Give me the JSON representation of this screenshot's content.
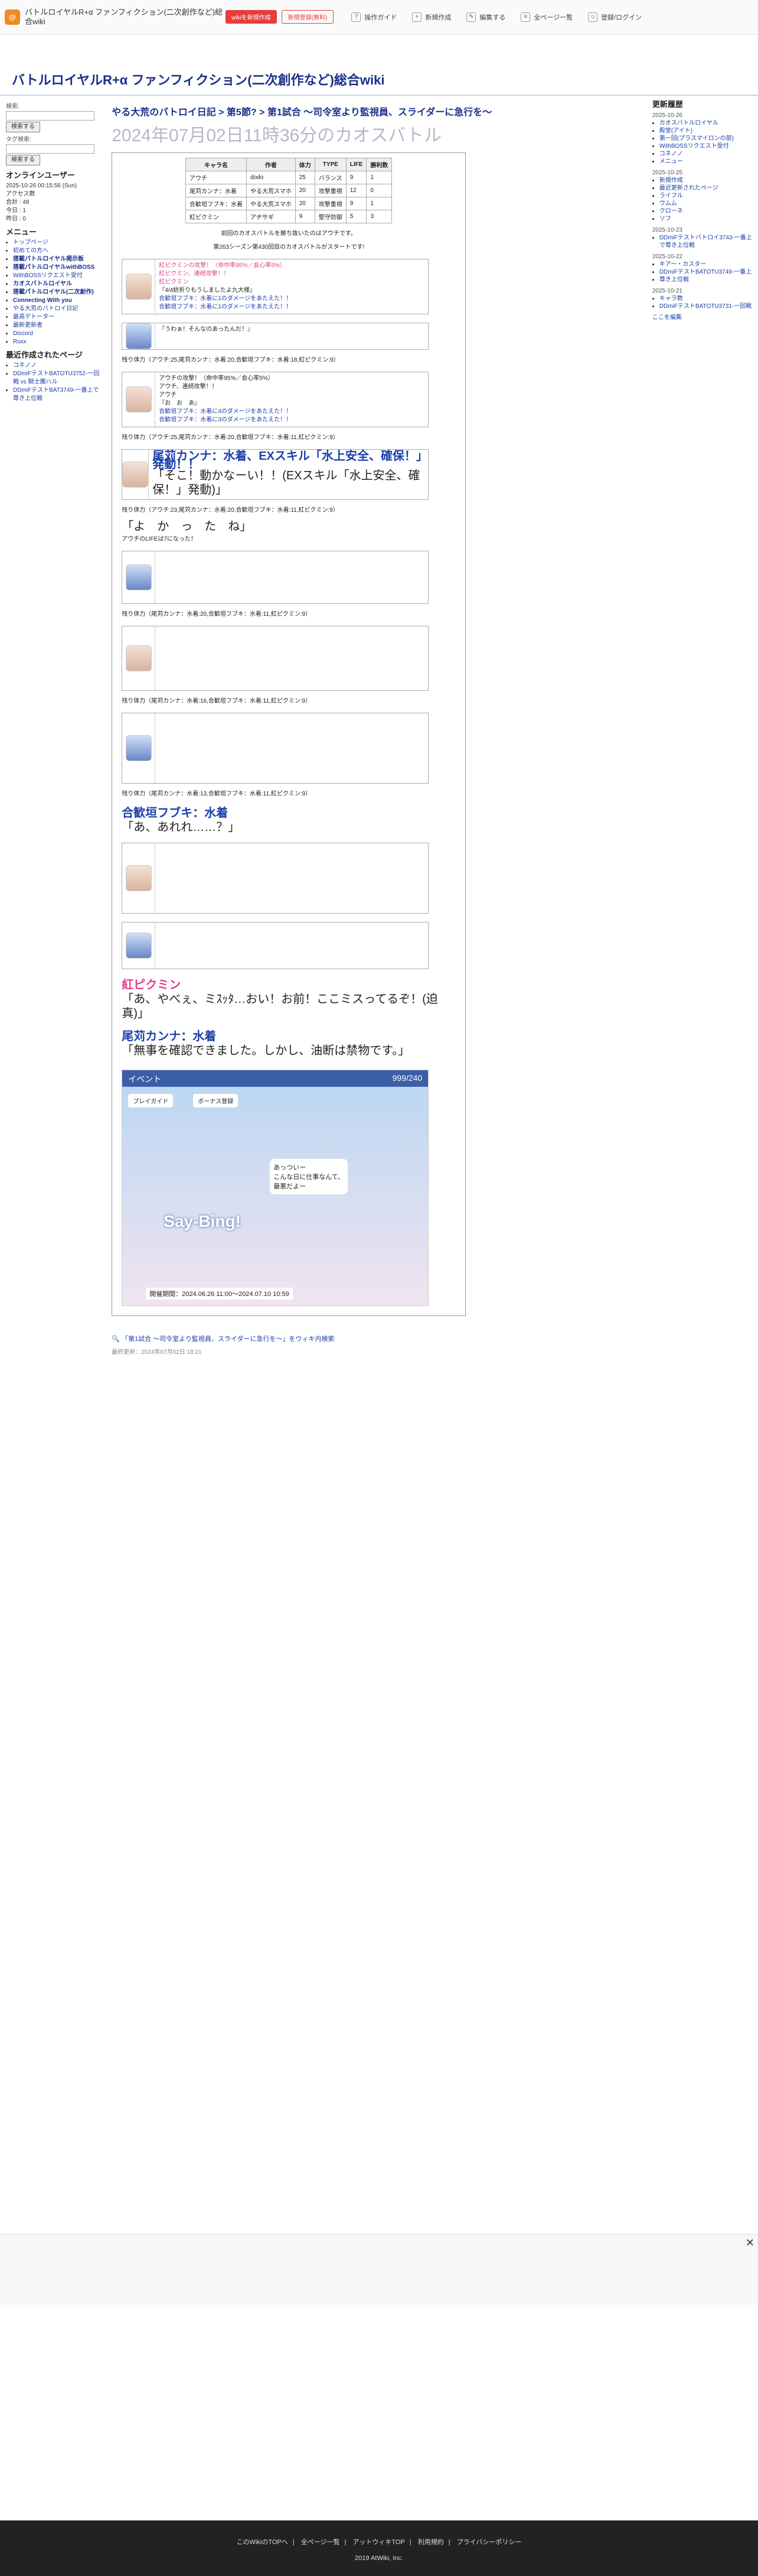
{
  "header": {
    "site_name": "バトルロイヤルR+α ファンフィクション(二次創作など)総合wiki",
    "btn_new": "wikiを新規作成",
    "btn_login": "新規登録(無料)",
    "tools": [
      "操作ガイド",
      "新規作成",
      "編集する",
      "全ページ一覧",
      "登録/ログイン"
    ]
  },
  "wiki_title": "バトルロイヤルR+α ファンフィクション(二次創作など)総合wiki",
  "sidebar": {
    "search_label": "検索:",
    "search_btn": "検索する",
    "tag_label": "タグ検索:",
    "tag_btn": "検索する",
    "online": "オンラインユーザー",
    "updated": "2025-10-26 00:15:56 (Sun)",
    "counts": [
      "アクセス数",
      "合計 : 48",
      "今日 : 1",
      "昨日 : 0"
    ],
    "menu_title": "メニュー",
    "menu": [
      "トップページ",
      "初めての方へ",
      "搭載パトルロイヤル掲示板",
      "搭載パトルロイヤルwithBOSS",
      "WithBOSSリクエスト受付",
      "カオスバトルロイヤル",
      "搭載パトルロイヤル(二次創作)",
      "Connecting With you",
      "やる大荒のバトロイ日記",
      "最高デトーター",
      "最新更新者",
      "Discord",
      "Roxx"
    ],
    "recent_title": "最近作成されたページ",
    "recent": [
      "コネノノ",
      "DDmiFテストBATOTU3752-一回戦 vs 騎士團ハル",
      "DDmiFテストBAT3749-一番上で尊き上位戦"
    ]
  },
  "breadcrumb": "やる大荒のバトロイ日記 > 第5節? > 第1試合 〜司令室より監視員、スライダーに急行を〜",
  "page_title": "2024年07月02日11時36分のカオスバトル",
  "char_table": {
    "headers": [
      "キャラ名",
      "作者",
      "体力",
      "TYPE",
      "LIFE",
      "勝利数"
    ],
    "rows": [
      [
        "アウチ",
        "dodo",
        "25",
        "バランス",
        "9",
        "1"
      ],
      [
        "尾苅カンナ：水着",
        "やる大荒スマホ",
        "20",
        "攻撃重視",
        "12",
        "0"
      ],
      [
        "合歓垣フブキ：水着",
        "やる大荒スマホ",
        "20",
        "攻撃重視",
        "9",
        "1"
      ],
      [
        "紅ピクミン",
        "アヂサギ",
        "9",
        "堅守防御",
        "5",
        "3"
      ]
    ]
  },
  "battle_intro": "前回のカオスバトルを勝ち抜いたのはアウチです。",
  "battle_start": "第263シーズン第430回目のカオスバトルがスタートです!",
  "events": [
    {
      "speaker": "紅ピクミン",
      "lines": [
        "紅ピクミンの攻撃！（命中率95%／会心率5%）",
        "紅ピクミン、連続攻撃！！",
        "紅ピクミン",
        "『4/4紡折りもうしましたよ九大様』",
        "合歓垣フブキ：水着に1のダメージをあたえた！！",
        "合歓垣フブキ：水着に1のダメージをあたえた！！"
      ]
    },
    {
      "speaker": "アウチ",
      "lines": [
        "『うわぁ！そんなのあったんだ！』"
      ]
    },
    {
      "remain": "残り体力（アウチ:25,尾苅カンナ：水着:20,合歓垣フブキ：水着:18,紅ピクミン:9）"
    },
    {
      "speaker": "アウチ",
      "lines": [
        "アウチの攻撃！（命中率95%／会心率5%）",
        "アウチ、連続攻撃！！",
        "アウチ",
        "『お　お　あ』",
        "合歓垣フブキ：水着に4のダメージをあたえた！！",
        "合歓垣フブキ：水着に3のダメージをあたえた！！"
      ]
    },
    {
      "remain": "残り体力（アウチ:25,尾苅カンナ：水着:20,合歓垣フブキ：水着:11,紅ピクミン:9）"
    },
    {
      "big": "尾苅カンナ：水着、EXスキル「水上安全、確保！」発動！！",
      "sub": "「そこ！動かなーい！！(EXスキル「水上安全、確保！」発動)」"
    },
    {
      "remain": "残り体力（アウチ:23,尾苅カンナ：水着:20,合歓垣フブキ：水着:11,紅ピクミン:9）"
    },
    {
      "big": "「よ　か　っ　た　ね」",
      "sub": "アウチのLIFEは7になった！"
    },
    {
      "remain": "残り体力（尾苅カンナ：水着:20,合歓垣フブキ：水着:11,紅ピクミン:9）"
    },
    {
      "remain": "残り体力（尾苅カンナ：水着:16,合歓垣フブキ：水着:11,紅ピクミン:9）"
    },
    {
      "remain": "残り体力（尾苅カンナ：水着:13,合歓垣フブキ：水着:11,紅ピクミン:9）"
    },
    {
      "big": "合歓垣フブキ：水着",
      "sub": "「あ、あれれ……？」"
    },
    {
      "big": "紅ピクミン",
      "sub": "「あ、やべぇ、ミｽｯﾀ…おい！お前！ここミスってるぞ！(迫真)」"
    },
    {
      "big": "尾苅カンナ：水着",
      "sub": "「無事を確認できました。しかし、油断は禁物です。」"
    }
  ],
  "game_banner": {
    "title": "イベント",
    "counter": "999/240",
    "button1": "プレイガイド",
    "button2": "ボーナス登録",
    "slogan": "Say-Bing!",
    "period": "開催期間：2024.06.26 11:00〜2024.07.10 10:59",
    "speech": "あっついー\nこんな日に仕事なんて、\n最悪だよー"
  },
  "edit_link": "「第1試合 〜司令室より監視員、スライダーに急行を〜」をウィキ内検索",
  "last_updated": "最終更新：2024年07月02日 18:21",
  "right": {
    "title": "更新履歴",
    "groups": [
      {
        "date": "2025-10-26",
        "items": [
          "カオスバトルロイヤル",
          "殿堂(アイト)",
          "第一回(プラスマイロンの部)",
          "WithBOSSリクエスト受付",
          "コネノノ",
          "メニュー"
        ]
      },
      {
        "date": "2025-10-25",
        "items": [
          "新規作成",
          "最近更新されたページ",
          "ライフル",
          "ウムム",
          "クローネ",
          "ソフ"
        ]
      },
      {
        "date": "2025-10-23",
        "items": [
          "DDmiFテストバトロイ3743-一番上で尊き上位戦"
        ]
      },
      {
        "date": "2025-10-22",
        "items": [
          "キアー・カスター",
          "DDmiFテストBATOTU3749-一番上",
          "尊き上位戦"
        ]
      },
      {
        "date": "2025-10-21",
        "items": [
          "キャラ数",
          "DDmiFテストBATOTU3731-一回戦"
        ]
      }
    ],
    "footer_link": "ここを編集"
  },
  "footer": {
    "links": [
      "このWikiのTOPへ",
      "全ページ一覧",
      "アットウィキTOP",
      "利用規約",
      "プライバシーポリシー"
    ],
    "copyright": "2019 AtWiki, Inc."
  }
}
